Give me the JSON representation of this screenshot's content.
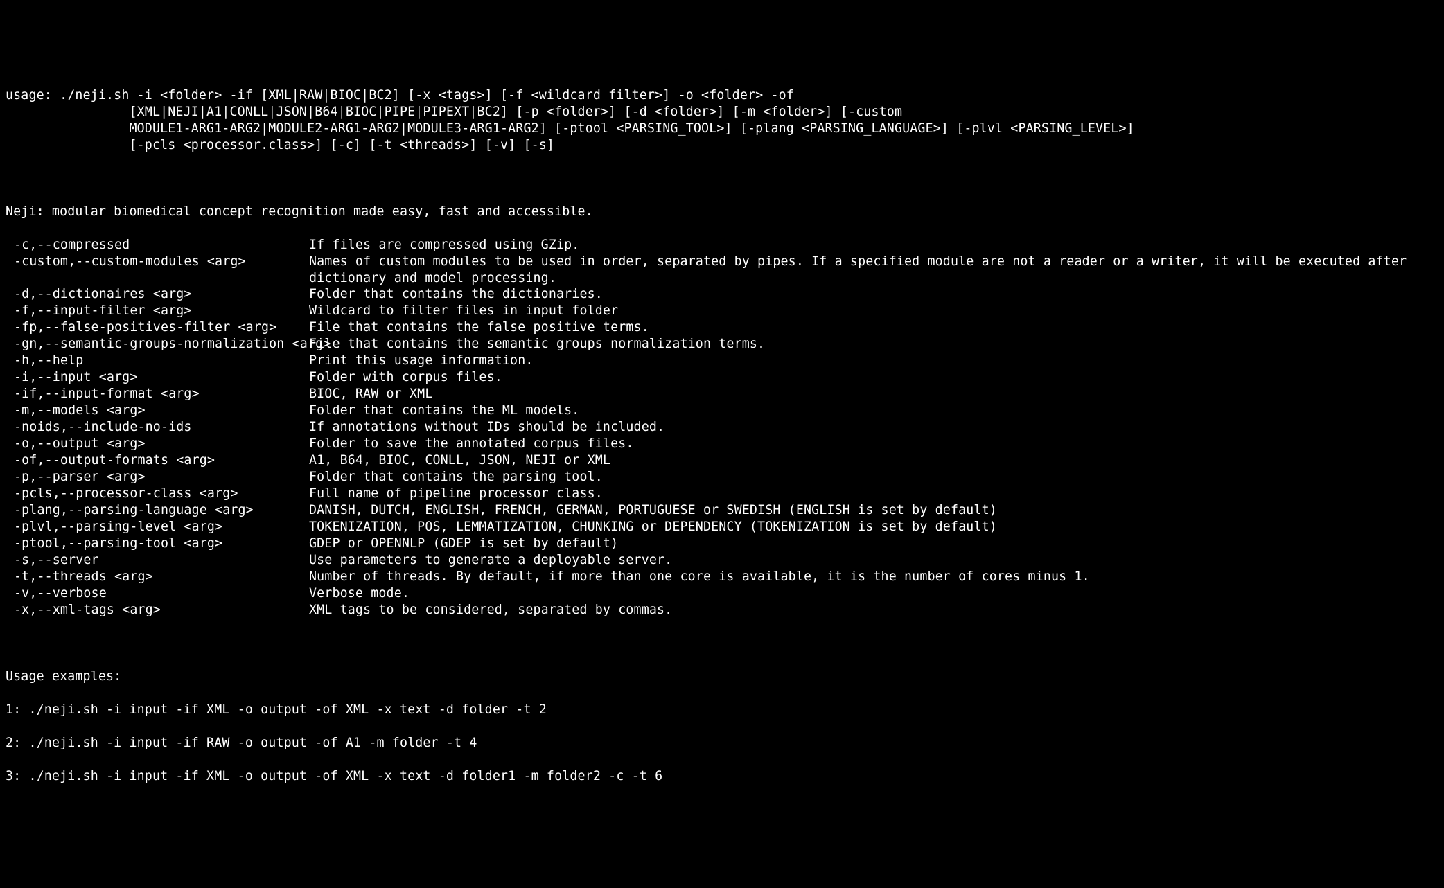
{
  "usage_prefix": "usage: ",
  "usage_lines": [
    "./neji.sh -i <folder> -if [XML|RAW|BIOC|BC2] [-x <tags>] [-f <wildcard filter>] -o <folder> -of",
    "[XML|NEJI|A1|CONLL|JSON|B64|BIOC|PIPE|PIPEXT|BC2] [-p <folder>] [-d <folder>] [-m <folder>] [-custom",
    "MODULE1-ARG1-ARG2|MODULE2-ARG1-ARG2|MODULE3-ARG1-ARG2] [-ptool <PARSING_TOOL>] [-plang <PARSING_LANGUAGE>] [-plvl <PARSING_LEVEL>]",
    "[-pcls <processor.class>] [-c] [-t <threads>] [-v] [-s]"
  ],
  "description": "Neji: modular biomedical concept recognition made easy, fast and accessible.",
  "options": [
    {
      "flag": "-c,--compressed",
      "desc": "If files are compressed using GZip."
    },
    {
      "flag": "-custom,--custom-modules <arg>",
      "desc": "Names of custom modules to be used in order, separated by pipes. If a specified module are not a reader or a writer, it will be executed after dictionary and model processing."
    },
    {
      "flag": "-d,--dictionaires <arg>",
      "desc": "Folder that contains the dictionaries."
    },
    {
      "flag": "-f,--input-filter <arg>",
      "desc": "Wildcard to filter files in input folder"
    },
    {
      "flag": "-fp,--false-positives-filter <arg>",
      "desc": "File that contains the false positive terms."
    },
    {
      "flag": "-gn,--semantic-groups-normalization <arg>",
      "desc": "File that contains the semantic groups normalization terms."
    },
    {
      "flag": "-h,--help",
      "desc": "Print this usage information."
    },
    {
      "flag": "-i,--input <arg>",
      "desc": "Folder with corpus files."
    },
    {
      "flag": "-if,--input-format <arg>",
      "desc": "BIOC, RAW or XML"
    },
    {
      "flag": "-m,--models <arg>",
      "desc": "Folder that contains the ML models."
    },
    {
      "flag": "-noids,--include-no-ids",
      "desc": "If annotations without IDs should be included."
    },
    {
      "flag": "-o,--output <arg>",
      "desc": "Folder to save the annotated corpus files."
    },
    {
      "flag": "-of,--output-formats <arg>",
      "desc": "A1, B64, BIOC, CONLL, JSON, NEJI or XML"
    },
    {
      "flag": "-p,--parser <arg>",
      "desc": "Folder that contains the parsing tool."
    },
    {
      "flag": "-pcls,--processor-class <arg>",
      "desc": "Full name of pipeline processor class."
    },
    {
      "flag": "-plang,--parsing-language <arg>",
      "desc": "DANISH, DUTCH, ENGLISH, FRENCH, GERMAN, PORTUGUESE or SWEDISH (ENGLISH is set by default)"
    },
    {
      "flag": "-plvl,--parsing-level <arg>",
      "desc": "TOKENIZATION, POS, LEMMATIZATION, CHUNKING or DEPENDENCY (TOKENIZATION is set by default)"
    },
    {
      "flag": "-ptool,--parsing-tool <arg>",
      "desc": "GDEP or OPENNLP (GDEP is set by default)"
    },
    {
      "flag": "-s,--server",
      "desc": "Use parameters to generate a deployable server."
    },
    {
      "flag": "-t,--threads <arg>",
      "desc": "Number of threads. By default, if more than one core is available, it is the number of cores minus 1."
    },
    {
      "flag": "-v,--verbose",
      "desc": "Verbose mode."
    },
    {
      "flag": "-x,--xml-tags <arg>",
      "desc": "XML tags to be considered, separated by commas."
    }
  ],
  "examples_heading": "Usage examples:",
  "examples": [
    "1: ./neji.sh -i input -if XML -o output -of XML -x text -d folder -t 2",
    "2: ./neji.sh -i input -if RAW -o output -of A1 -m folder -t 4",
    "3: ./neji.sh -i input -if XML -o output -of XML -x text -d folder1 -m folder2 -c -t 6"
  ]
}
